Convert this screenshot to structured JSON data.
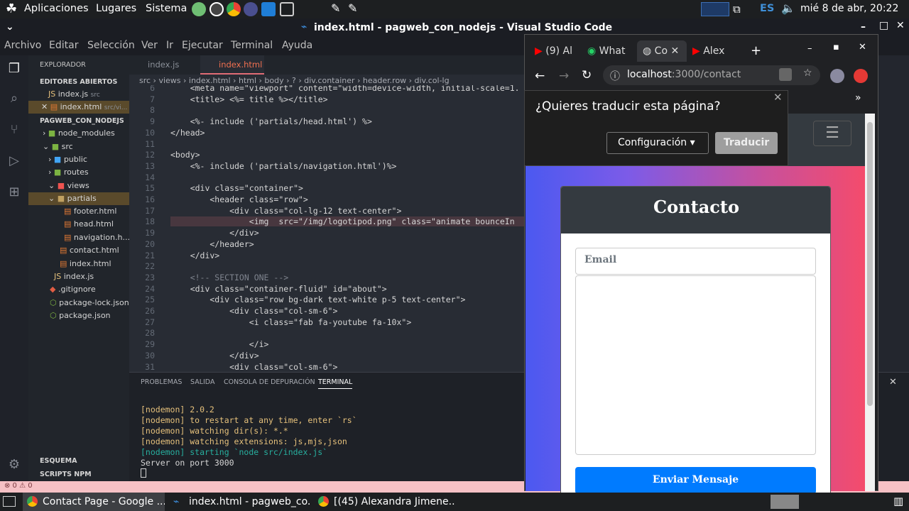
{
  "topbar": {
    "apps": "Aplicaciones",
    "places": "Lugares",
    "system": "Sistema",
    "lang": "ES",
    "datetime": "mié  8 de abr, 20:22"
  },
  "vscode": {
    "window_title": "index.html - pagweb_con_nodejs - Visual Studio Code",
    "menu": [
      "Archivo",
      "Editar",
      "Selección",
      "Ver",
      "Ir",
      "Ejecutar",
      "Terminal",
      "Ayuda"
    ],
    "explorer_title": "EXPLORADOR",
    "open_editors": "EDITORES ABIERTOS",
    "open_files": [
      {
        "name": "index.js",
        "dir": "src"
      },
      {
        "name": "index.html",
        "dir": "src/vi..."
      }
    ],
    "project": "PAGWEB_CON_NODEJS",
    "tree": [
      "node_modules",
      "src",
      "public",
      "routes",
      "views",
      "partials",
      "footer.html",
      "head.html",
      "navigation.h...",
      "contact.html",
      "index.html",
      "index.js",
      ".gitignore",
      "package-lock.json",
      "package.json"
    ],
    "outline": "ESQUEMA",
    "npm": "SCRIPTS NPM",
    "tabs": [
      "index.js",
      "index.html"
    ],
    "breadcrumb": "src › views › index.html › html › body › ? › div.container › header.row › div.col-lg",
    "lines": [
      "6",
      "7",
      "8",
      "9",
      "10",
      "11",
      "12",
      "13",
      "14",
      "15",
      "16",
      "17",
      "18",
      "19",
      "20",
      "21",
      "22",
      "23",
      "24",
      "25",
      "26",
      "27",
      "28",
      "29",
      "30",
      "31"
    ],
    "code": [
      "    <meta name=\"viewport\" content=\"width=device-width, initial-scale=1.",
      "    <title> <%= title %></title>",
      "",
      "    <%- include ('partials/head.html') %>",
      "</head>",
      "",
      "<body>",
      "    <%- include ('partials/navigation.html')%>",
      "",
      "    <div class=\"container\">",
      "        <header class=\"row\">",
      "            <div class=\"col-lg-12 text-center\">",
      "                <img  src=\"/img/logotipod.png\" class=\"animate bounceIn",
      "            </div>",
      "        </header>",
      "    </div>",
      "",
      "    <!-- SECTION ONE -->",
      "    <div class=\"container-fluid\" id=\"about\">",
      "        <div class=\"row bg-dark text-white p-5 text-center\">",
      "            <div class=\"col-sm-6\">",
      "                <i class=\"fab fa-youtube fa-10x\">",
      "",
      "                </i>",
      "            </div>",
      "            <div class=\"col-sm-6\">"
    ],
    "panel_tabs": [
      "PROBLEMAS",
      "SALIDA",
      "CONSOLA DE DEPURACIÓN",
      "TERMINAL"
    ],
    "terminal": [
      "[nodemon] 2.0.2",
      "[nodemon] to restart at any time, enter `rs`",
      "[nodemon] watching dir(s): *.*",
      "[nodemon] watching extensions: js,mjs,json",
      "[nodemon] starting `node src/index.js`",
      "Server on port 3000"
    ],
    "status": "⊗ 0 ⚠ 0"
  },
  "chrome": {
    "tabs": [
      "(9) Al",
      "What",
      "Co",
      "Alex"
    ],
    "url_host": "localhost",
    "url_path": ":3000/contact",
    "translate_q": "¿Quieres traducir esta página?",
    "translate_config": "Configuración",
    "translate_btn": "Traducir",
    "overflow": "»"
  },
  "page": {
    "card_title": "Contacto",
    "email_placeholder": "Email",
    "submit": "Enviar Mensaje"
  },
  "taskbar": [
    "Contact Page - Google ...",
    "index.html - pagweb_co...",
    "[(45) Alexandra Jimene..."
  ]
}
